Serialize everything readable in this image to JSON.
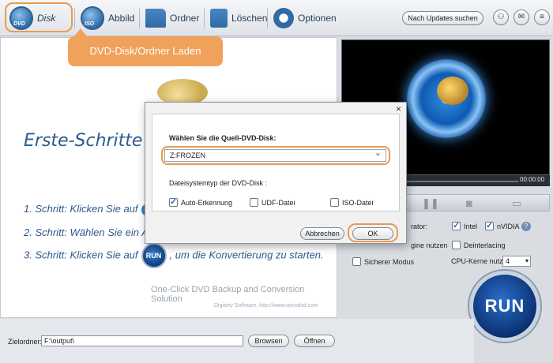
{
  "toolbar": {
    "disk_label": "Disk",
    "disk_icon_tag": "DVD",
    "image_label": "Abbild",
    "image_icon_tag": "ISO",
    "folder_label": "Ordner",
    "delete_label": "Löschen",
    "options_label": "Optionen",
    "update_label": "Nach Updates suchen",
    "account_icon": "person-icon",
    "mail_icon": "mail-icon",
    "menu_icon": "menu-icon"
  },
  "tooltip": {
    "text": "DVD-Disk/Ordner Laden"
  },
  "main": {
    "headline": "Erste-Schritte",
    "step1": "1. Schritt: Klicken Sie auf",
    "step2": "2. Schritt: Wählen Sie ein A",
    "step3_pre": "3. Schritt: Klicken Sie auf",
    "step3_run": "RUN",
    "step3_post": ", um die Konvertierung zu starten.",
    "tagline": "One-Click DVD Backup and Conversion Solution",
    "company": "Digiarty Software, http://www.winxdvd.com"
  },
  "preview": {
    "time": "00:00:00"
  },
  "options": {
    "accelerator_label": "rator:",
    "intel_label": "Intel",
    "intel_checked": true,
    "nvidia_label": "nVIDIA",
    "nvidia_checked": true,
    "engine_label": "gine nutzen",
    "deinterlace_label": "Deinterlacing",
    "deinterlace_checked": false,
    "safe_mode_label": "Sicherer Modus",
    "safe_mode_checked": false,
    "cpu_label": "CPU-Kerne nutzen",
    "cpu_value": "4"
  },
  "run_button": "RUN",
  "bottom": {
    "target_label": "Zielordner:",
    "target_value": "F:\\output\\",
    "browse_label": "Browsen",
    "open_label": "Öffnen"
  },
  "dialog": {
    "close_glyph": "×",
    "source_label": "Wählen Sie die Quell-DVD-Disk:",
    "source_value": "Z:FROZEN",
    "fs_label": "Dateisystemtyp der DVD-Disk :",
    "fs_options": [
      {
        "label": "Auto-Erkennung",
        "checked": true
      },
      {
        "label": "UDF-Datei",
        "checked": false
      },
      {
        "label": "ISO-Datei",
        "checked": false
      }
    ],
    "cancel_label": "Abbrechen",
    "ok_label": "OK"
  },
  "colors": {
    "accent_orange": "#e89a4e",
    "brand_blue": "#2e5b8e"
  }
}
